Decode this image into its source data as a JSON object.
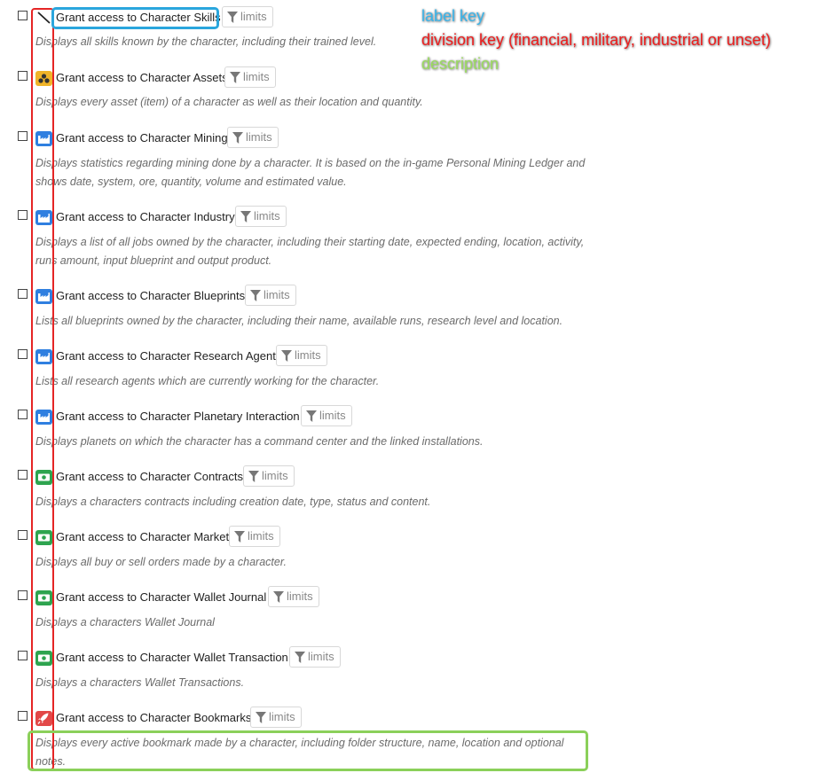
{
  "annotations": {
    "label_key": "label key",
    "division_key": "division key (financial, military, industrial or unset)",
    "description": "description"
  },
  "colors": {
    "label_key": "#2aa6dd",
    "division_key": "#e52525",
    "description": "#8bd05a",
    "industrial": "#2f7fe0",
    "financial": "#2ea44f",
    "military": "#e24848",
    "assets": "#f0b429"
  },
  "limits_label": "limits",
  "items": [
    {
      "title": "Grant access to Character Skills",
      "division": "unset",
      "icon": "slash-icon",
      "description": "Displays all skills known by the character, including their trained level."
    },
    {
      "title": "Grant access to Character Assets",
      "division": "assets",
      "icon": "cubes-icon",
      "description": "Displays every asset (item) of a character as well as their location and quantity."
    },
    {
      "title": "Grant access to Character Mining",
      "division": "industrial",
      "icon": "industry-icon",
      "description": "Displays statistics regarding mining done by a character. It is based on the in-game Personal Mining Ledger and shows date, system, ore, quantity, volume and estimated value."
    },
    {
      "title": "Grant access to Character Industry",
      "division": "industrial",
      "icon": "industry-icon",
      "description": "Displays a list of all jobs owned by the character, including their starting date, expected ending, location, activity, runs amount, input blueprint and output product."
    },
    {
      "title": "Grant access to Character Blueprints",
      "division": "industrial",
      "icon": "industry-icon",
      "description": "Lists all blueprints owned by the character, including their name, available runs, research level and location."
    },
    {
      "title": "Grant access to Character Research Agents",
      "division": "industrial",
      "icon": "industry-icon",
      "description": "Lists all research agents which are currently working for the character."
    },
    {
      "title": "Grant access to Character Planetary Interaction",
      "division": "industrial",
      "icon": "industry-icon",
      "description": "Displays planets on which the character has a command center and the linked installations."
    },
    {
      "title": "Grant access to Character Contracts",
      "division": "financial",
      "icon": "money-icon",
      "description": "Displays a characters contracts including creation date, type, status and content."
    },
    {
      "title": "Grant access to Character Market",
      "division": "financial",
      "icon": "money-icon",
      "description": "Displays all buy or sell orders made by a character."
    },
    {
      "title": "Grant access to Character Wallet Journal",
      "division": "financial",
      "icon": "money-icon",
      "description": "Displays a characters Wallet Journal"
    },
    {
      "title": "Grant access to Character Wallet Transaction",
      "division": "financial",
      "icon": "money-icon",
      "description": "Displays a characters Wallet Transactions."
    },
    {
      "title": "Grant access to Character Bookmarks",
      "division": "military",
      "icon": "rocket-icon",
      "description": "Displays every active bookmark made by a character, including folder structure, name, location and optional notes."
    }
  ]
}
